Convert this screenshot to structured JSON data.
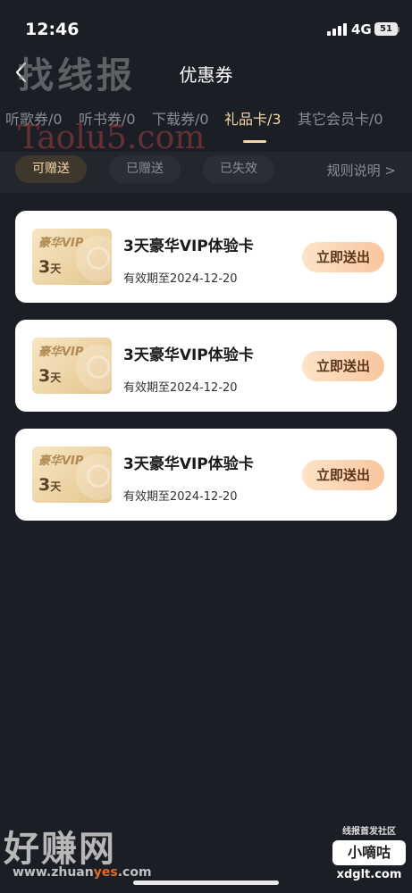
{
  "status_bar": {
    "time": "12:46",
    "network": "4G",
    "battery": "51"
  },
  "header": {
    "title": "优惠券"
  },
  "tabs": [
    {
      "label": "听歌券/0"
    },
    {
      "label": "听书券/0"
    },
    {
      "label": "下载券/0"
    },
    {
      "label": "礼品卡/3",
      "active": true
    },
    {
      "label": "其它会员卡/0"
    }
  ],
  "filters": {
    "items": [
      "可赠送",
      "已赠送",
      "已失效"
    ],
    "active": "可赠送",
    "rules_link": "规则说明 >"
  },
  "cards": [
    {
      "brand": "豪华VIP",
      "days_num": "3",
      "days_unit": "天",
      "title": "3天豪华VIP体验卡",
      "expiry": "有效期至2024-12-20",
      "action": "立即送出"
    },
    {
      "brand": "豪华VIP",
      "days_num": "3",
      "days_unit": "天",
      "title": "3天豪华VIP体验卡",
      "expiry": "有效期至2024-12-20",
      "action": "立即送出"
    },
    {
      "brand": "豪华VIP",
      "days_num": "3",
      "days_unit": "天",
      "title": "3天豪华VIP体验卡",
      "expiry": "有效期至2024-12-20",
      "action": "立即送出"
    }
  ],
  "watermarks": {
    "top": "找线报",
    "url": "Taolu5.com",
    "bottom": "好赚网",
    "bottom_url_a": "www.zhuan",
    "bottom_url_b": "yes",
    "bottom_url_c": ".com",
    "badge_top": "线报首发社区",
    "badge_main": "小嘀咕",
    "badge_bottom": "xdglt.com"
  },
  "colors": {
    "background": "#1c1e26",
    "accent": "#f3d7a8",
    "button": "#f8c69d"
  }
}
